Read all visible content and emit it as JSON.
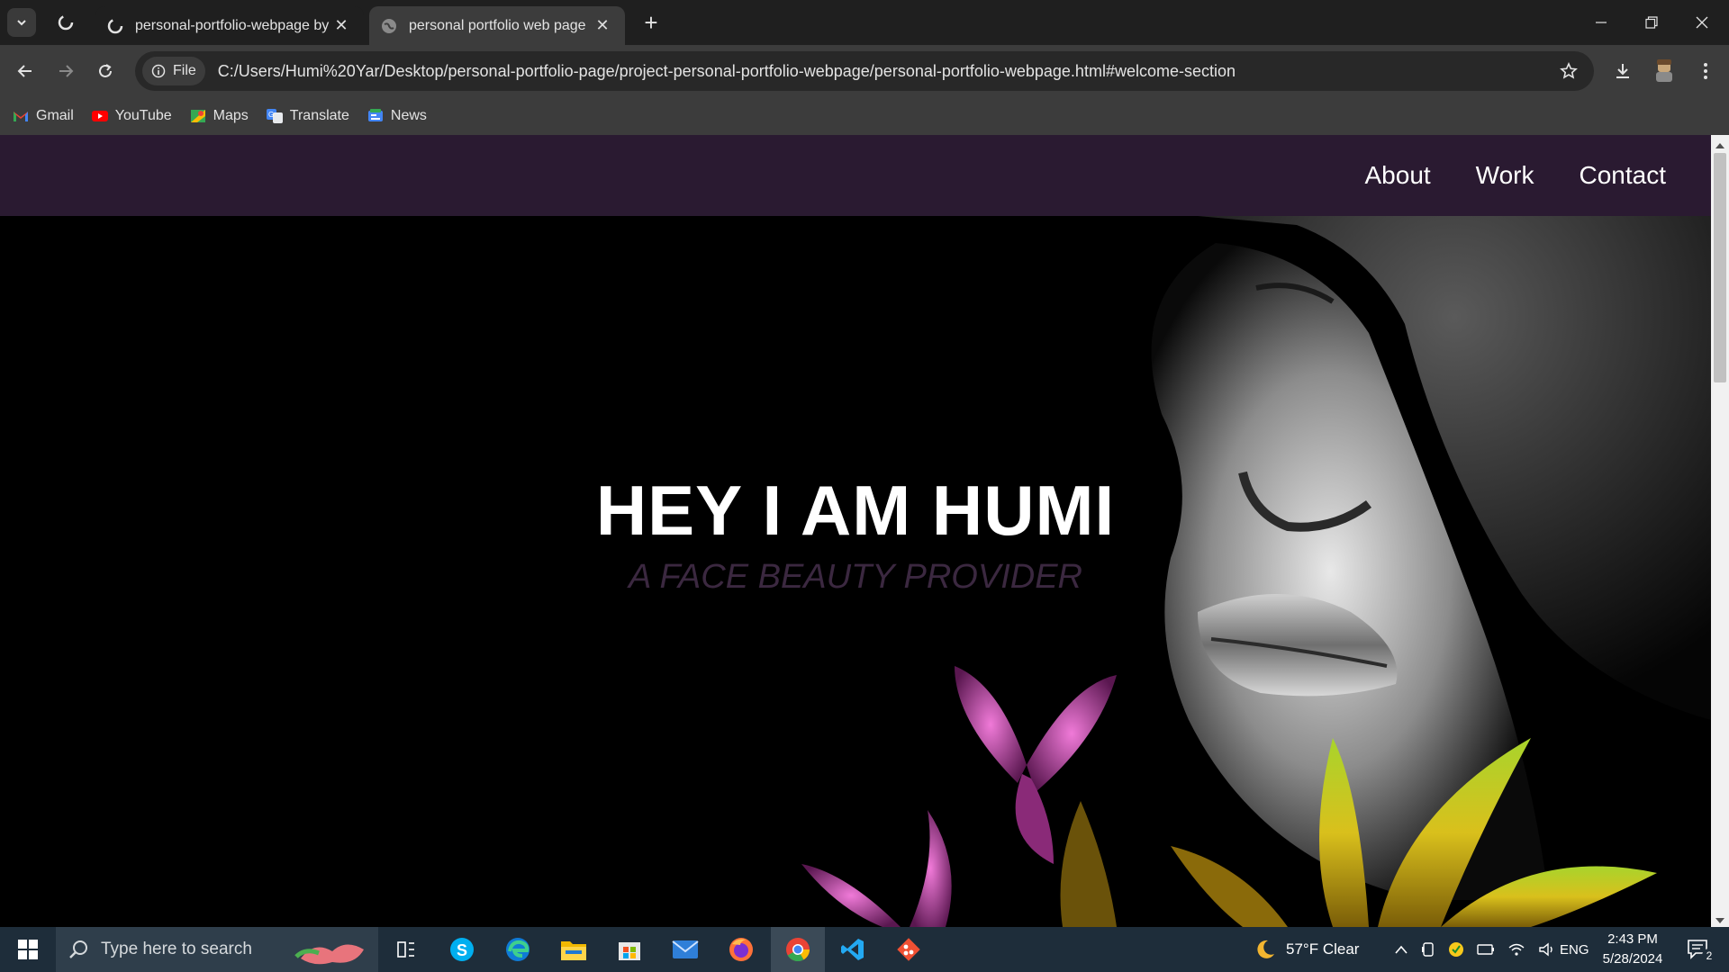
{
  "browser": {
    "tabs": [
      {
        "title": "personal-portfolio-webpage by",
        "active": false
      },
      {
        "title": "personal portfolio web page",
        "active": true
      }
    ],
    "new_tab_label": "+",
    "site_chip": "File",
    "url": "C:/Users/Humi%20Yar/Desktop/personal-portfolio-page/project-personal-portfolio-webpage/personal-portfolio-webpage.html#welcome-section",
    "bookmarks": [
      {
        "label": "Gmail",
        "icon": "gmail-icon"
      },
      {
        "label": "YouTube",
        "icon": "youtube-icon"
      },
      {
        "label": "Maps",
        "icon": "maps-icon"
      },
      {
        "label": "Translate",
        "icon": "translate-icon"
      },
      {
        "label": "News",
        "icon": "news-icon"
      }
    ]
  },
  "page": {
    "nav": [
      {
        "label": "About"
      },
      {
        "label": "Work"
      },
      {
        "label": "Contact"
      }
    ],
    "hero_title": "HEY I AM HUMI",
    "hero_subtitle": "A FACE BEAUTY PROVIDER",
    "colors": {
      "navbar": "#2a1a31",
      "subtitle": "#3b2840"
    }
  },
  "taskbar": {
    "search_placeholder": "Type here to search",
    "weather": "57°F  Clear",
    "language": "ENG",
    "time": "2:43 PM",
    "date": "5/28/2024",
    "notification_count": "2"
  }
}
